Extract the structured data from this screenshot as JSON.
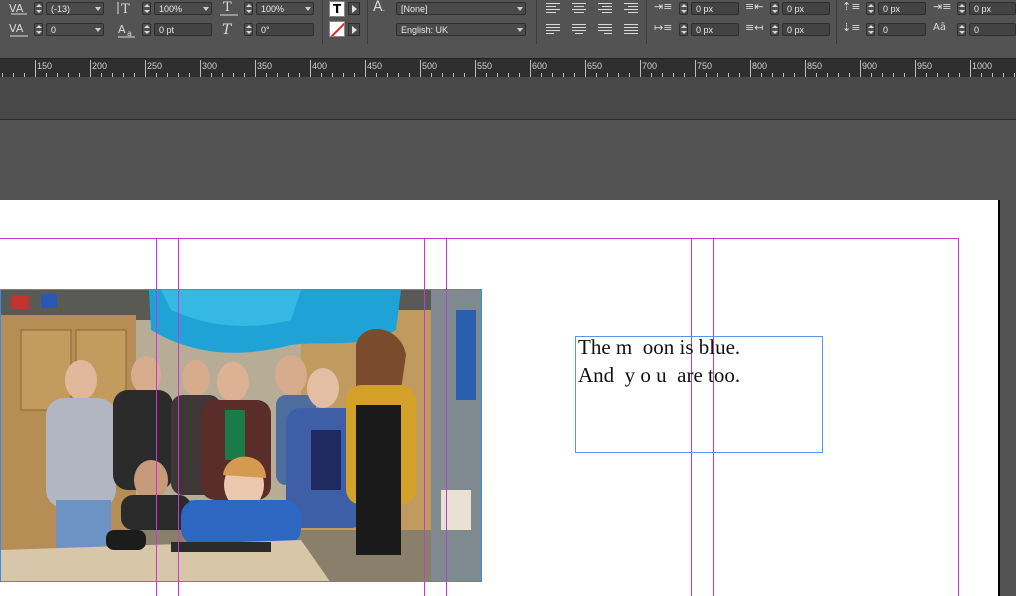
{
  "control_panel": {
    "row1": {
      "kerning_value": "(-13)",
      "vertical_scale": "100%",
      "horizontal_scale": "100%",
      "char_style": "[None]",
      "left_indent": "0 px",
      "right_indent": "0 px",
      "space_before": "0 px",
      "drop_cap_lines": "0 px"
    },
    "row2": {
      "tracking_value": "0",
      "baseline_shift": "0 pt",
      "skew": "0°",
      "language": "English: UK",
      "first_line_indent": "0 px",
      "last_line_indent": "0 px",
      "space_after": "0",
      "drop_cap_chars": "0"
    }
  },
  "ruler": {
    "labels": [
      "150",
      "200",
      "250",
      "300",
      "350",
      "400",
      "450",
      "500",
      "550",
      "600",
      "650",
      "700",
      "750",
      "800",
      "850",
      "900",
      "950",
      "1000"
    ]
  },
  "document": {
    "text_lines": [
      "The m  oon is blue.",
      "And  y o u  are too."
    ],
    "colors": {
      "margin_guide": "#c53ccd",
      "frame_border": "#5a95e6"
    }
  }
}
